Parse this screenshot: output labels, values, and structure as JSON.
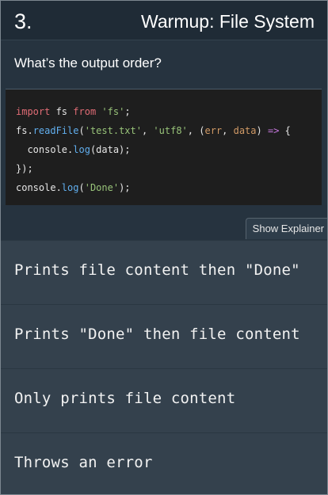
{
  "header": {
    "question_number": "3.",
    "title": "Warmup: File System"
  },
  "prompt": "What’s the output order?",
  "code": {
    "lines": [
      "import fs from 'fs';",
      "fs.readFile('test.txt', 'utf8', (err, data) => {",
      "  console.log(data);",
      "});",
      "console.log('Done');"
    ]
  },
  "explainer_button": "Show Explainer",
  "answers": [
    "Prints file content then \"Done\"",
    "Prints \"Done\" then file content",
    "Only prints file content",
    "Throws an error"
  ],
  "colors": {
    "background": "#26333f",
    "header": "#1f2b36",
    "code_background": "#1e1e1e",
    "answer_background": "#34414d",
    "keyword": "#e06c75",
    "string": "#98c379",
    "function": "#61afef",
    "parameter": "#d19a66"
  }
}
